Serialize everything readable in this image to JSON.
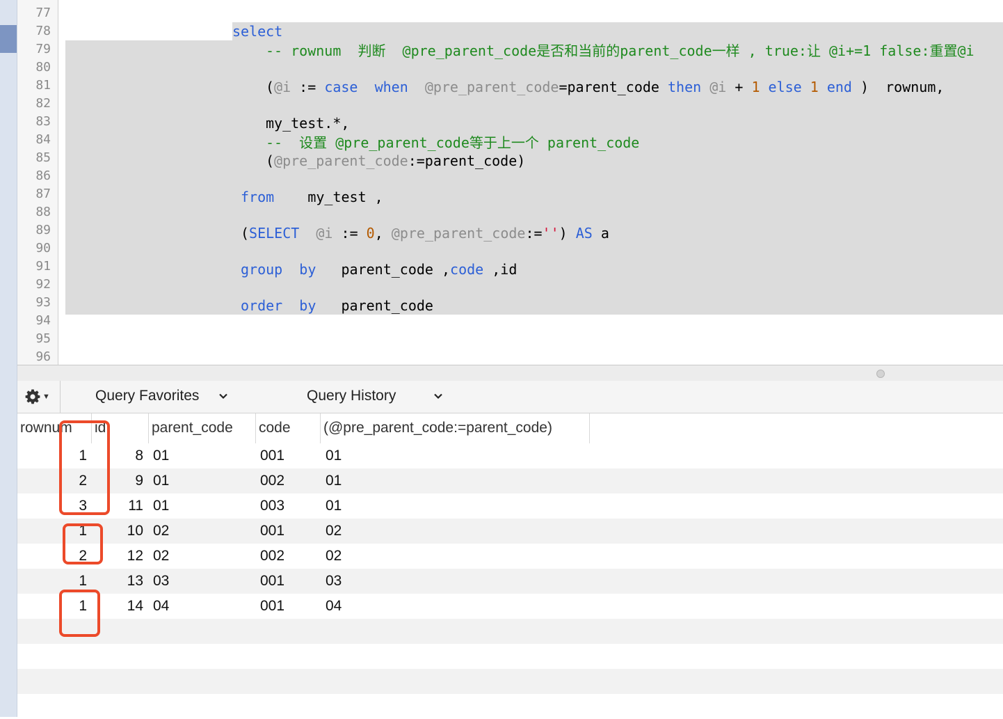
{
  "editor": {
    "line_numbers": [
      "77",
      "78",
      "79",
      "80",
      "81",
      "82",
      "83",
      "84",
      "85",
      "86",
      "87",
      "88",
      "89",
      "90",
      "91",
      "92",
      "93",
      "94",
      "95",
      "96"
    ],
    "lines": {
      "l78_select": "select",
      "l79_a": "-- rownum  判断  @pre_parent_code是否和当前的parent_code一样 , true:让 @i+=1 false:重置@i",
      "l81_open": "(",
      "l81_var1": "@i",
      "l81_assign": " := ",
      "l81_case": "case",
      "l81_when": "  when  ",
      "l81_var2": "@pre_parent_code",
      "l81_eq": "=parent_code ",
      "l81_then": "then",
      "l81_sp": " ",
      "l81_var3": "@i",
      "l81_plus": " + ",
      "l81_one": "1",
      "l81_else": " else ",
      "l81_one2": "1",
      "l81_end": " end",
      "l81_tail": " )  rownum,",
      "l83": "my_test.*,",
      "l84": "--  设置 @pre_parent_code等于上一个 parent_code",
      "l85_open": "(",
      "l85_var": "@pre_parent_code",
      "l85_tail": ":=parent_code)",
      "l87_from": "from",
      "l87_tail": "    my_test ,",
      "l89_open": "(",
      "l89_select": "SELECT",
      "l89_sp": "  ",
      "l89_var1": "@i",
      "l89_assign": " := ",
      "l89_zero": "0",
      "l89_comma": ", ",
      "l89_var2": "@pre_parent_code",
      "l89_assign2": ":=",
      "l89_str": "''",
      "l89_close": ") ",
      "l89_as": "AS",
      "l89_a": " a",
      "l91_group": "group",
      "l91_by": "  by",
      "l91_mid": "   parent_code ,",
      "l91_code": "code",
      "l91_tail": " ,id",
      "l93_order": "order",
      "l93_by": "  by",
      "l93_tail": "   parent_code"
    }
  },
  "toolbar": {
    "gear": "gear-icon",
    "favorites_label": "Query Favorites",
    "history_label": "Query History"
  },
  "results": {
    "columns": [
      "rownum",
      "id",
      "parent_code",
      "code",
      "(@pre_parent_code:=parent_code)"
    ],
    "rows": [
      [
        "1",
        "8",
        "01",
        "001",
        "01"
      ],
      [
        "2",
        "9",
        "01",
        "002",
        "01"
      ],
      [
        "3",
        "11",
        "01",
        "003",
        "01"
      ],
      [
        "1",
        "10",
        "02",
        "001",
        "02"
      ],
      [
        "2",
        "12",
        "02",
        "002",
        "02"
      ],
      [
        "1",
        "13",
        "03",
        "001",
        "03"
      ],
      [
        "1",
        "14",
        "04",
        "001",
        "04"
      ]
    ]
  },
  "colors": {
    "keyword": "#2c5fd6",
    "comment": "#1f8a1f",
    "variable": "#8c8c8c",
    "number": "#b45a00",
    "annotation": "#ec4a2a",
    "selection": "#dcdcdc"
  }
}
